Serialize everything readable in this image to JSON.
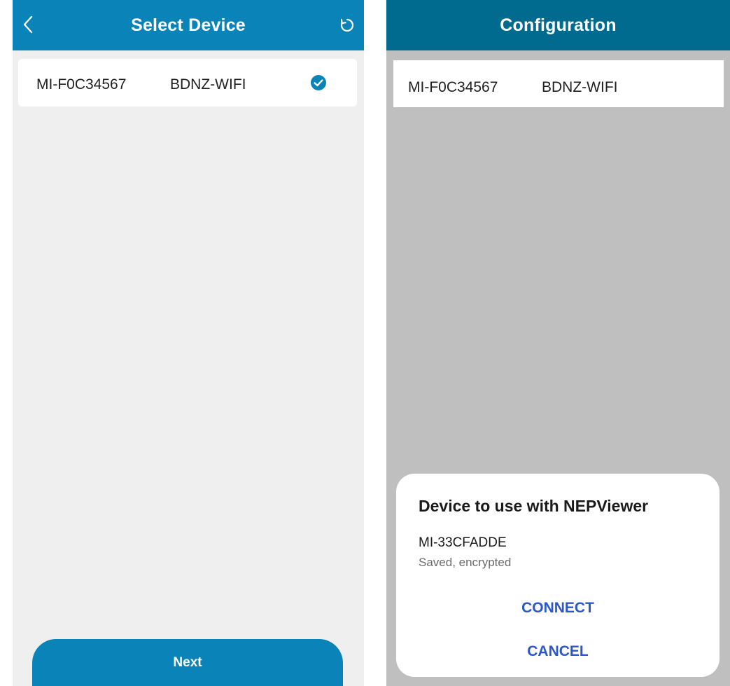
{
  "colors": {
    "header_left": "#0a84b8",
    "header_right": "#006a8f",
    "accent": "#0a84b8",
    "dialog_button": "#2a57c9",
    "left_background": "#efefef",
    "right_background": "#bfbfbf"
  },
  "select_screen": {
    "title": "Select Device",
    "back_icon": "chevron-left-icon",
    "refresh_icon": "refresh-icon",
    "device": {
      "id": "MI-F0C34567",
      "network": "BDNZ-WIFI",
      "selected": true,
      "selected_icon": "check-circle-icon"
    },
    "next_label": "Next"
  },
  "configuration_screen": {
    "title": "Configuration",
    "device": {
      "id": "MI-F0C34567",
      "network": "BDNZ-WIFI"
    },
    "dialog": {
      "title": "Device to use with NEPViewer",
      "device_name": "MI-33CFADDE",
      "device_status": "Saved, encrypted",
      "connect_label": "CONNECT",
      "cancel_label": "CANCEL"
    }
  }
}
